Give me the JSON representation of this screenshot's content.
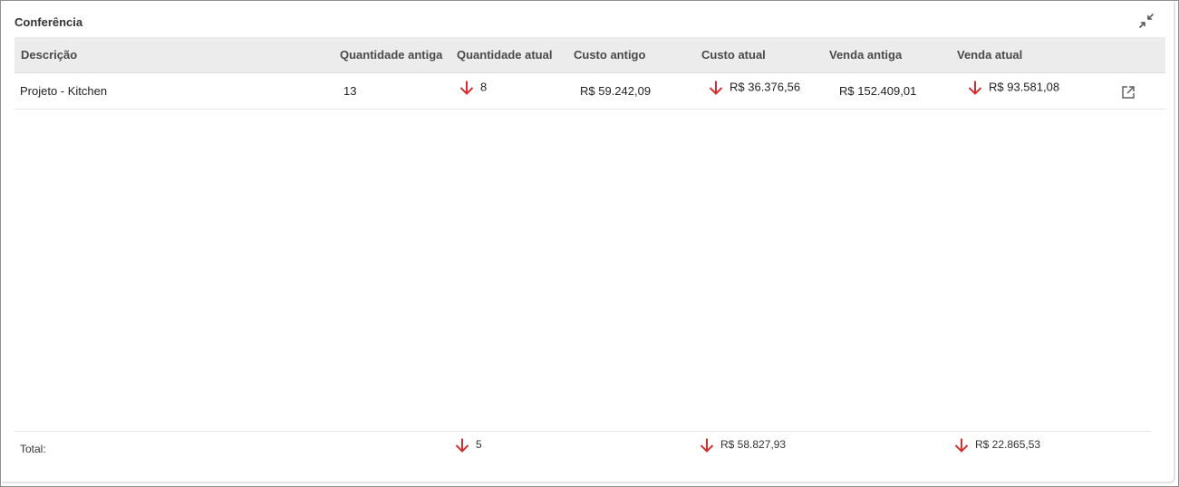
{
  "panel": {
    "title": "Conferência",
    "collapse_icon": "collapse-icon"
  },
  "table": {
    "headers": {
      "descricao": "Descrição",
      "qtd_antiga": "Quantidade antiga",
      "qtd_atual": "Quantidade atual",
      "custo_antigo": "Custo antigo",
      "custo_atual": "Custo atual",
      "venda_antiga": "Venda antiga",
      "venda_atual": "Venda atual"
    },
    "rows": [
      {
        "descricao": "Projeto - Kitchen",
        "qtd_antiga": "13",
        "qtd_atual": "8",
        "custo_antigo": "R$ 59.242,09",
        "custo_atual": "R$ 36.376,56",
        "venda_antiga": "R$ 152.409,01",
        "venda_atual": "R$ 93.581,08",
        "trend_icon": "arrow-down-icon",
        "open_icon": "open-in-new-icon"
      }
    ]
  },
  "total": {
    "label": "Total:",
    "qtd": "5",
    "custo": "R$ 58.827,93",
    "venda": "R$ 22.865,53"
  },
  "colors": {
    "decrease": "#d32f2f",
    "header_bg": "#ececec"
  }
}
